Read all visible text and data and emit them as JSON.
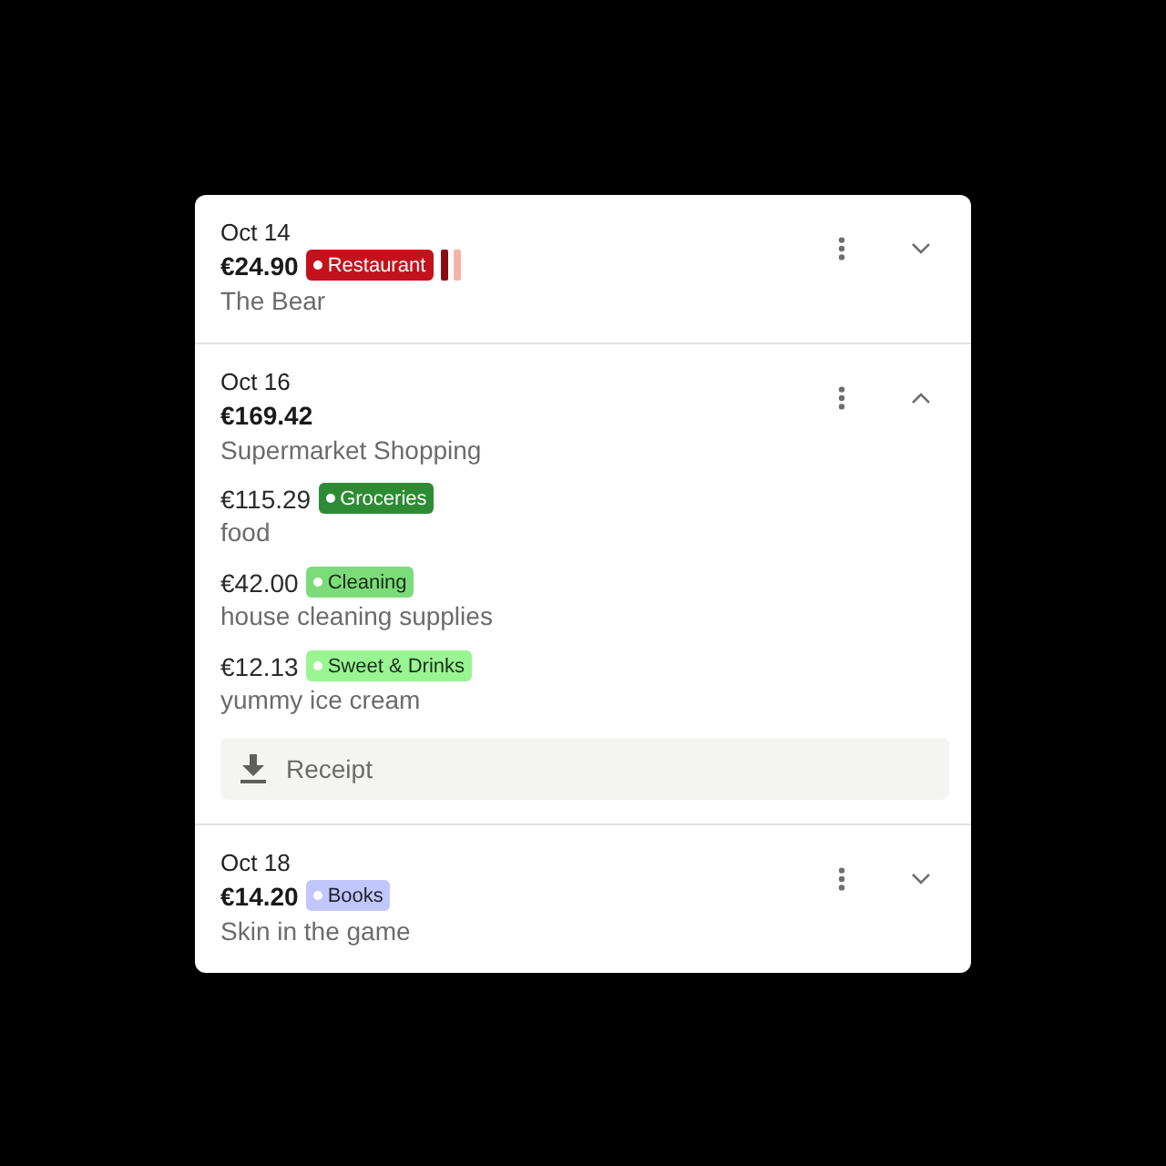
{
  "transactions": [
    {
      "date": "Oct 14",
      "amount": "€24.90",
      "description": "The Bear",
      "expanded": false,
      "tags": [
        {
          "label": "Restaurant",
          "color": "#c4121c"
        }
      ],
      "extra_tags": [
        {
          "color": "#8a0a12"
        },
        {
          "color": "#f5b3a6"
        }
      ]
    },
    {
      "date": "Oct 16",
      "amount": "€169.42",
      "description": "Supermarket Shopping",
      "expanded": true,
      "items": [
        {
          "amount": "€115.29",
          "tag": {
            "label": "Groceries",
            "color": "#2e8b35"
          },
          "note": "food"
        },
        {
          "amount": "€42.00",
          "tag": {
            "label": "Cleaning",
            "color": "#7ddc7a"
          },
          "note": "house cleaning supplies"
        },
        {
          "amount": "€12.13",
          "tag": {
            "label": "Sweet & Drinks",
            "color": "#98f592"
          },
          "note": "yummy ice cream"
        }
      ],
      "receipt": {
        "label": "Receipt"
      }
    },
    {
      "date": "Oct 18",
      "amount": "€14.20",
      "description": "Skin in the game",
      "expanded": false,
      "tags": [
        {
          "label": "Books",
          "color": "#c2c6ff"
        }
      ]
    }
  ]
}
